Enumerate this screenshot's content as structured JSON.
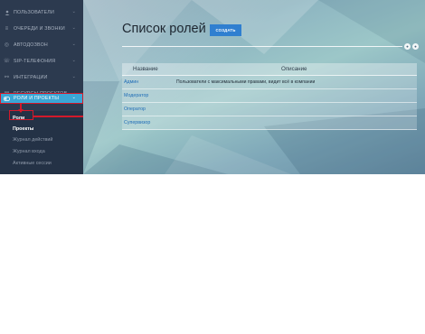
{
  "sidebar": {
    "items": [
      {
        "label": "Пользователи",
        "icon": "user-icon"
      },
      {
        "label": "Очереди и звонки",
        "icon": "queue-icon"
      },
      {
        "label": "Автодозвон",
        "icon": "autodial-icon"
      },
      {
        "label": "SIP-телефония",
        "icon": "phone-icon"
      },
      {
        "label": "Интеграции",
        "icon": "integration-icon"
      },
      {
        "label": "Ресурсы проектов",
        "icon": "resources-icon"
      },
      {
        "label": "Роли и проекты",
        "icon": "toggle-icon",
        "active": true
      }
    ],
    "subitems": [
      {
        "label": "Роли",
        "active": true
      },
      {
        "label": "Проекты",
        "bold": true
      },
      {
        "label": "Журнал действий"
      },
      {
        "label": "Журнал входа"
      },
      {
        "label": "Активные сессии"
      }
    ]
  },
  "main": {
    "title": "Список ролей",
    "create_label": "создать",
    "table": {
      "columns": [
        "Название",
        "Описание"
      ],
      "rows": [
        {
          "name": "Админ",
          "description": "Пользователи с максимальными правами, видит всё в компании"
        },
        {
          "name": "Модератор",
          "description": ""
        },
        {
          "name": "Оператор",
          "description": ""
        },
        {
          "name": "Супервизор",
          "description": ""
        }
      ]
    }
  },
  "colors": {
    "sidebar_bg": "#2c3a4f",
    "active_item": "#3aa7d6",
    "highlight": "#d3192b",
    "button": "#2f7fd0",
    "link": "#1f6db7"
  }
}
